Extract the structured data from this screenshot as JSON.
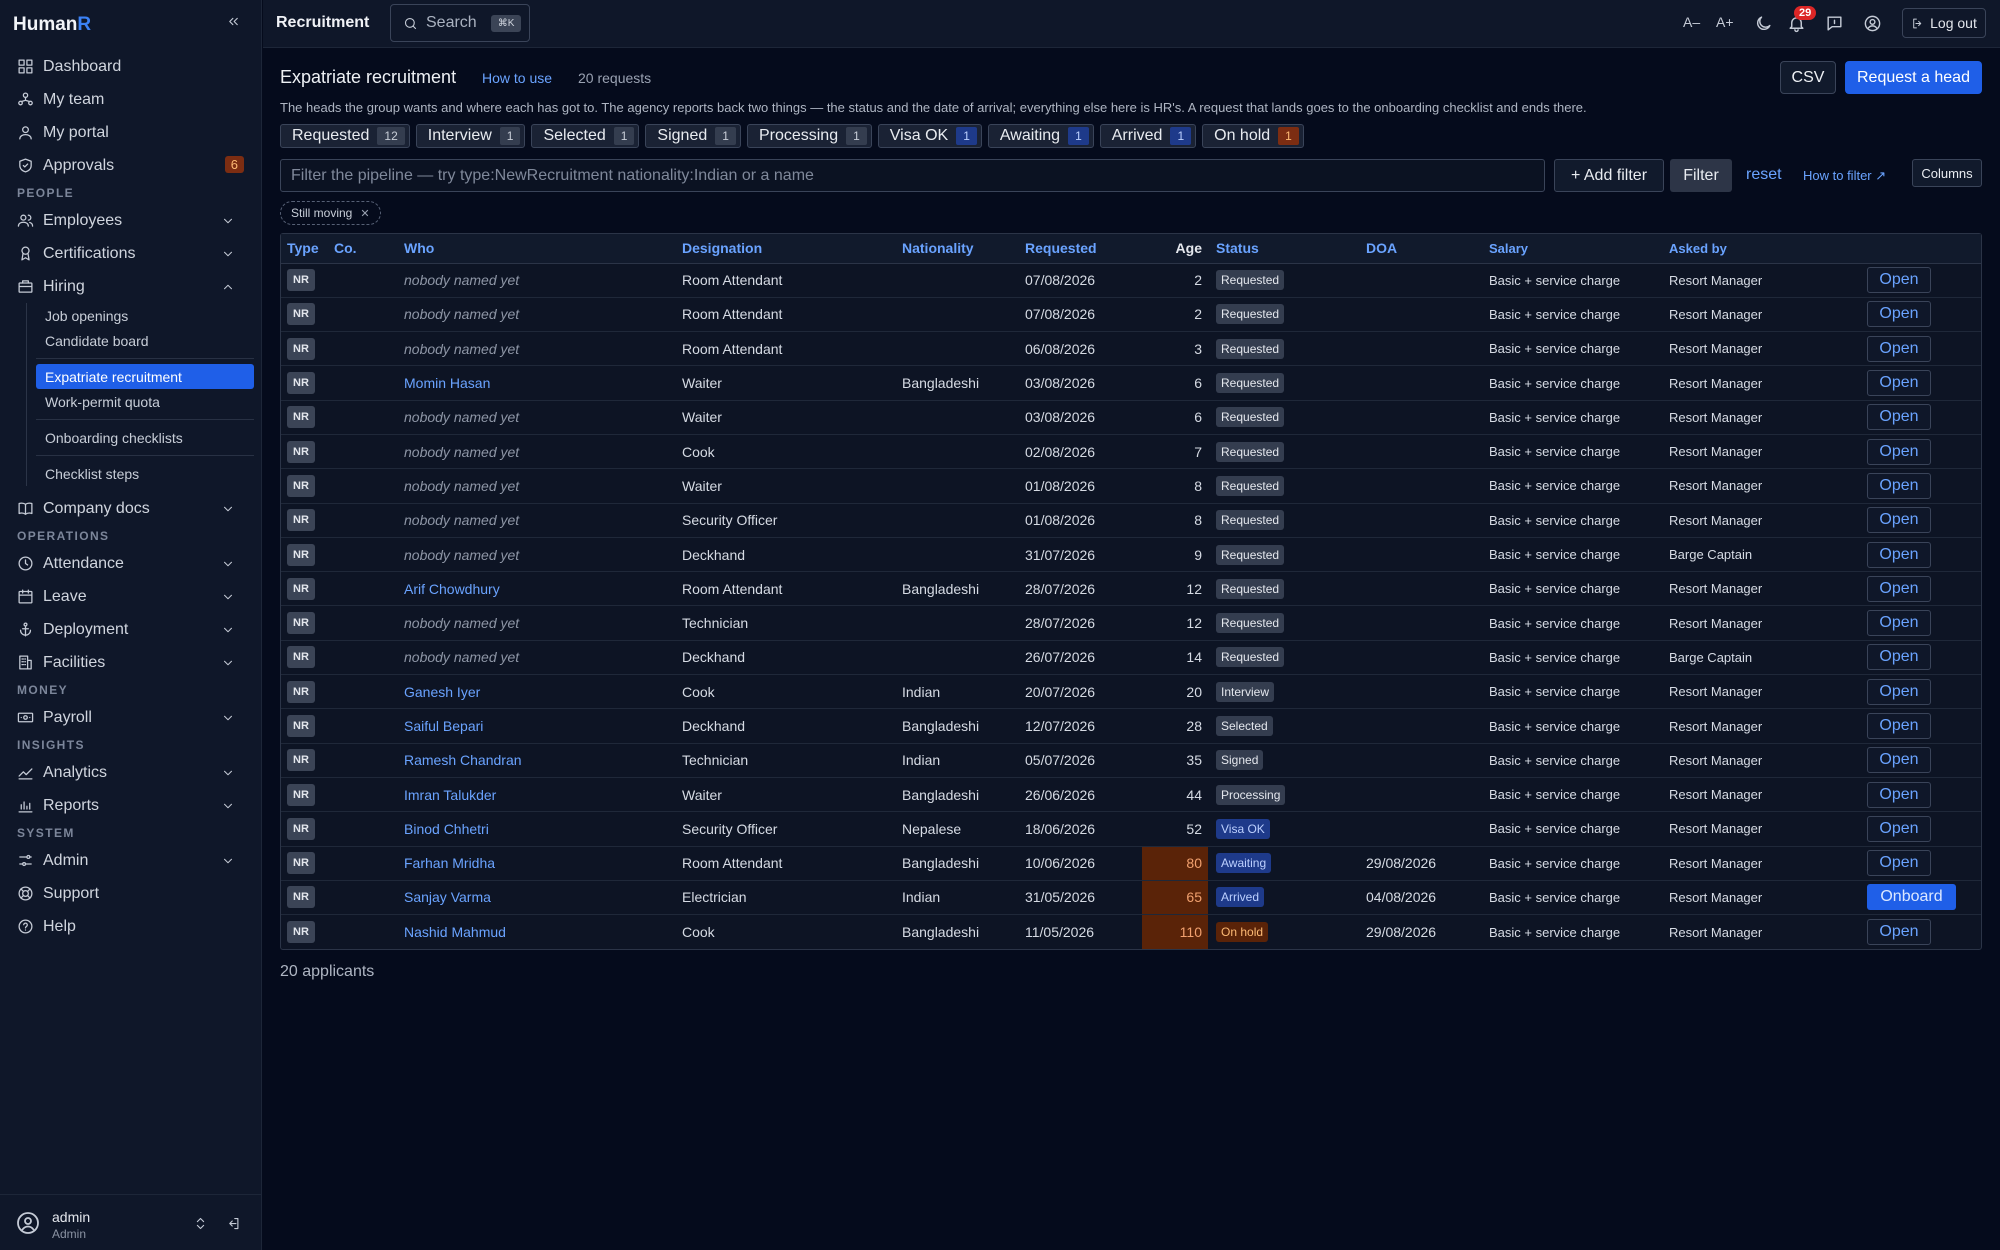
{
  "brand": {
    "prefix": "Human",
    "suffix": "R"
  },
  "sidebar": {
    "top_items": [
      {
        "label": "Dashboard"
      },
      {
        "label": "My team"
      },
      {
        "label": "My portal"
      },
      {
        "label": "Approvals",
        "badge": "6"
      }
    ],
    "sections": {
      "people": "PEOPLE",
      "operations": "OPERATIONS",
      "money": "MONEY",
      "insights": "INSIGHTS",
      "system": "SYSTEM"
    },
    "people_items": [
      {
        "label": "Employees"
      },
      {
        "label": "Certifications"
      },
      {
        "label": "Hiring"
      }
    ],
    "hiring_sub": [
      {
        "label": "Job openings"
      },
      {
        "label": "Candidate board"
      },
      {
        "label": "Expatriate recruitment"
      },
      {
        "label": "Work-permit quota"
      },
      {
        "label": "Onboarding checklists"
      },
      {
        "label": "Checklist steps"
      }
    ],
    "company_docs": "Company docs",
    "operations_items": [
      {
        "label": "Attendance"
      },
      {
        "label": "Leave"
      },
      {
        "label": "Deployment"
      },
      {
        "label": "Facilities"
      }
    ],
    "money_items": [
      {
        "label": "Payroll"
      }
    ],
    "insights_items": [
      {
        "label": "Analytics"
      },
      {
        "label": "Reports"
      }
    ],
    "system_items": [
      {
        "label": "Admin"
      },
      {
        "label": "Support"
      },
      {
        "label": "Help"
      }
    ],
    "user": {
      "name": "admin",
      "role": "Admin"
    }
  },
  "topbar": {
    "title": "Recruitment",
    "search_label": "Search",
    "search_kbd": "⌘K",
    "font_smaller": "A–",
    "font_larger": "A+",
    "notifications": "29",
    "logout": "Log out"
  },
  "page": {
    "title": "Expatriate recruitment",
    "how_to_use": "How to use",
    "request_count": "20 requests",
    "csv": "CSV",
    "request_head": "Request a head",
    "description": "The heads the group wants and where each has got to. The agency reports back two things — the status and the date of arrival; everything else here is HR's. A request that lands goes to the onboarding checklist and ends there.",
    "stages": [
      {
        "label": "Requested",
        "count": "12",
        "tone": "gray"
      },
      {
        "label": "Interview",
        "count": "1",
        "tone": "gray"
      },
      {
        "label": "Selected",
        "count": "1",
        "tone": "gray"
      },
      {
        "label": "Signed",
        "count": "1",
        "tone": "gray"
      },
      {
        "label": "Processing",
        "count": "1",
        "tone": "gray"
      },
      {
        "label": "Visa OK",
        "count": "1",
        "tone": "blue"
      },
      {
        "label": "Awaiting",
        "count": "1",
        "tone": "blue"
      },
      {
        "label": "Arrived",
        "count": "1",
        "tone": "blue"
      },
      {
        "label": "On hold",
        "count": "1",
        "tone": "orange"
      }
    ],
    "filter_placeholder": "Filter the pipeline — try type:NewRecruitment nationality:Indian or a name",
    "add_filter": "+ Add filter",
    "filter": "Filter",
    "reset": "reset",
    "how_to_filter": "How to filter ↗",
    "columns": "Columns",
    "chip": "Still moving",
    "footer": "20 applicants"
  },
  "table": {
    "headers": [
      "Type",
      "Co.",
      "Who",
      "Designation",
      "Nationality",
      "Requested",
      "Age",
      "Status",
      "DOA",
      "Salary",
      "Asked by"
    ],
    "rows": [
      {
        "type": "NR",
        "co": "",
        "who": "nobody named yet",
        "named": false,
        "designation": "Room Attendant",
        "nationality": "",
        "requested": "07/08/2026",
        "age": "2",
        "hot": false,
        "status": "Requested",
        "tone": "gray",
        "doa": "",
        "salary": "Basic + service charge",
        "asked_by": "Resort Manager",
        "action": "Open"
      },
      {
        "type": "NR",
        "co": "",
        "who": "nobody named yet",
        "named": false,
        "designation": "Room Attendant",
        "nationality": "",
        "requested": "07/08/2026",
        "age": "2",
        "hot": false,
        "status": "Requested",
        "tone": "gray",
        "doa": "",
        "salary": "Basic + service charge",
        "asked_by": "Resort Manager",
        "action": "Open"
      },
      {
        "type": "NR",
        "co": "",
        "who": "nobody named yet",
        "named": false,
        "designation": "Room Attendant",
        "nationality": "",
        "requested": "06/08/2026",
        "age": "3",
        "hot": false,
        "status": "Requested",
        "tone": "gray",
        "doa": "",
        "salary": "Basic + service charge",
        "asked_by": "Resort Manager",
        "action": "Open"
      },
      {
        "type": "NR",
        "co": "",
        "who": "Momin Hasan",
        "named": true,
        "designation": "Waiter",
        "nationality": "Bangladeshi",
        "requested": "03/08/2026",
        "age": "6",
        "hot": false,
        "status": "Requested",
        "tone": "gray",
        "doa": "",
        "salary": "Basic + service charge",
        "asked_by": "Resort Manager",
        "action": "Open"
      },
      {
        "type": "NR",
        "co": "",
        "who": "nobody named yet",
        "named": false,
        "designation": "Waiter",
        "nationality": "",
        "requested": "03/08/2026",
        "age": "6",
        "hot": false,
        "status": "Requested",
        "tone": "gray",
        "doa": "",
        "salary": "Basic + service charge",
        "asked_by": "Resort Manager",
        "action": "Open"
      },
      {
        "type": "NR",
        "co": "",
        "who": "nobody named yet",
        "named": false,
        "designation": "Cook",
        "nationality": "",
        "requested": "02/08/2026",
        "age": "7",
        "hot": false,
        "status": "Requested",
        "tone": "gray",
        "doa": "",
        "salary": "Basic + service charge",
        "asked_by": "Resort Manager",
        "action": "Open"
      },
      {
        "type": "NR",
        "co": "",
        "who": "nobody named yet",
        "named": false,
        "designation": "Waiter",
        "nationality": "",
        "requested": "01/08/2026",
        "age": "8",
        "hot": false,
        "status": "Requested",
        "tone": "gray",
        "doa": "",
        "salary": "Basic + service charge",
        "asked_by": "Resort Manager",
        "action": "Open"
      },
      {
        "type": "NR",
        "co": "",
        "who": "nobody named yet",
        "named": false,
        "designation": "Security Officer",
        "nationality": "",
        "requested": "01/08/2026",
        "age": "8",
        "hot": false,
        "status": "Requested",
        "tone": "gray",
        "doa": "",
        "salary": "Basic + service charge",
        "asked_by": "Resort Manager",
        "action": "Open"
      },
      {
        "type": "NR",
        "co": "",
        "who": "nobody named yet",
        "named": false,
        "designation": "Deckhand",
        "nationality": "",
        "requested": "31/07/2026",
        "age": "9",
        "hot": false,
        "status": "Requested",
        "tone": "gray",
        "doa": "",
        "salary": "Basic + service charge",
        "asked_by": "Barge Captain",
        "action": "Open"
      },
      {
        "type": "NR",
        "co": "",
        "who": "Arif Chowdhury",
        "named": true,
        "designation": "Room Attendant",
        "nationality": "Bangladeshi",
        "requested": "28/07/2026",
        "age": "12",
        "hot": false,
        "status": "Requested",
        "tone": "gray",
        "doa": "",
        "salary": "Basic + service charge",
        "asked_by": "Resort Manager",
        "action": "Open"
      },
      {
        "type": "NR",
        "co": "",
        "who": "nobody named yet",
        "named": false,
        "designation": "Technician",
        "nationality": "",
        "requested": "28/07/2026",
        "age": "12",
        "hot": false,
        "status": "Requested",
        "tone": "gray",
        "doa": "",
        "salary": "Basic + service charge",
        "asked_by": "Resort Manager",
        "action": "Open"
      },
      {
        "type": "NR",
        "co": "",
        "who": "nobody named yet",
        "named": false,
        "designation": "Deckhand",
        "nationality": "",
        "requested": "26/07/2026",
        "age": "14",
        "hot": false,
        "status": "Requested",
        "tone": "gray",
        "doa": "",
        "salary": "Basic + service charge",
        "asked_by": "Barge Captain",
        "action": "Open"
      },
      {
        "type": "NR",
        "co": "",
        "who": "Ganesh Iyer",
        "named": true,
        "designation": "Cook",
        "nationality": "Indian",
        "requested": "20/07/2026",
        "age": "20",
        "hot": false,
        "status": "Interview",
        "tone": "gray",
        "doa": "",
        "salary": "Basic + service charge",
        "asked_by": "Resort Manager",
        "action": "Open"
      },
      {
        "type": "NR",
        "co": "",
        "who": "Saiful Bepari",
        "named": true,
        "designation": "Deckhand",
        "nationality": "Bangladeshi",
        "requested": "12/07/2026",
        "age": "28",
        "hot": false,
        "status": "Selected",
        "tone": "gray",
        "doa": "",
        "salary": "Basic + service charge",
        "asked_by": "Resort Manager",
        "action": "Open"
      },
      {
        "type": "NR",
        "co": "",
        "who": "Ramesh Chandran",
        "named": true,
        "designation": "Technician",
        "nationality": "Indian",
        "requested": "05/07/2026",
        "age": "35",
        "hot": false,
        "status": "Signed",
        "tone": "gray",
        "doa": "",
        "salary": "Basic + service charge",
        "asked_by": "Resort Manager",
        "action": "Open"
      },
      {
        "type": "NR",
        "co": "",
        "who": "Imran Talukder",
        "named": true,
        "designation": "Waiter",
        "nationality": "Bangladeshi",
        "requested": "26/06/2026",
        "age": "44",
        "hot": false,
        "status": "Processing",
        "tone": "gray",
        "doa": "",
        "salary": "Basic + service charge",
        "asked_by": "Resort Manager",
        "action": "Open"
      },
      {
        "type": "NR",
        "co": "",
        "who": "Binod Chhetri",
        "named": true,
        "designation": "Security Officer",
        "nationality": "Nepalese",
        "requested": "18/06/2026",
        "age": "52",
        "hot": false,
        "status": "Visa OK",
        "tone": "blue",
        "doa": "",
        "salary": "Basic + service charge",
        "asked_by": "Resort Manager",
        "action": "Open"
      },
      {
        "type": "NR",
        "co": "",
        "who": "Farhan Mridha",
        "named": true,
        "designation": "Room Attendant",
        "nationality": "Bangladeshi",
        "requested": "10/06/2026",
        "age": "80",
        "hot": true,
        "status": "Awaiting",
        "tone": "blue",
        "doa": "29/08/2026",
        "salary": "Basic + service charge",
        "asked_by": "Resort Manager",
        "action": "Open"
      },
      {
        "type": "NR",
        "co": "",
        "who": "Sanjay Varma",
        "named": true,
        "designation": "Electrician",
        "nationality": "Indian",
        "requested": "31/05/2026",
        "age": "65",
        "hot": true,
        "status": "Arrived",
        "tone": "blue",
        "doa": "04/08/2026",
        "salary": "Basic + service charge",
        "asked_by": "Resort Manager",
        "action": "Onboard"
      },
      {
        "type": "NR",
        "co": "",
        "who": "Nashid Mahmud",
        "named": true,
        "designation": "Cook",
        "nationality": "Bangladeshi",
        "requested": "11/05/2026",
        "age": "110",
        "hot": true,
        "status": "On hold",
        "tone": "orange",
        "doa": "29/08/2026",
        "salary": "Basic + service charge",
        "asked_by": "Resort Manager",
        "action": "Open"
      }
    ]
  },
  "colors": {
    "accent": "#1f5fe8",
    "link": "#6aa3ff",
    "background": "#050b1c",
    "sidebar": "#0f1729",
    "warn": "#5a2308"
  }
}
